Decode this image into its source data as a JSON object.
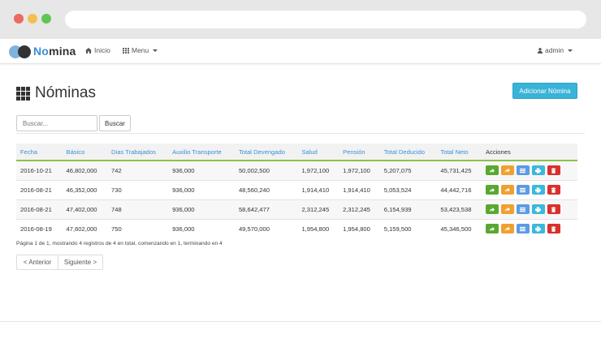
{
  "navbar": {
    "brand_no": "No",
    "brand_mina": "mina",
    "inicio": "Inicio",
    "menu": "Menu",
    "user": "admin"
  },
  "page": {
    "title": "Nóminas",
    "add_button": "Adicionar Nómina"
  },
  "search": {
    "placeholder": "Buscar...",
    "button": "Buscar"
  },
  "table": {
    "headers": [
      "Fecha",
      "Básico",
      "Dias Trabajados",
      "Auxilio Transporte",
      "Total Devengado",
      "Salud",
      "Pensión",
      "Total Deducido",
      "Total Neto",
      "Acciones"
    ],
    "rows": [
      [
        "2016-10-21",
        "46,802,000",
        "742",
        "936,000",
        "50,002,500",
        "1,972,100",
        "1,972,100",
        "5,207,075",
        "45,731,425"
      ],
      [
        "2016-08-21",
        "46,352,000",
        "730",
        "936,000",
        "48,560,240",
        "1,914,410",
        "1,914,410",
        "5,053,524",
        "44,442,716"
      ],
      [
        "2016-08-21",
        "47,402,000",
        "748",
        "936,000",
        "58,642,477",
        "2,312,245",
        "2,312,245",
        "6,154,939",
        "53,423,538"
      ],
      [
        "2016-08-19",
        "47,602,000",
        "750",
        "936,000",
        "49,570,000",
        "1,954,800",
        "1,954,800",
        "5,159,500",
        "45,346,500"
      ]
    ]
  },
  "pagination": {
    "info": "Página 1 de 1, mostrando 4 registros de 4 en total, comenzando en 1, terminando en 4",
    "prev": "< Anterior",
    "next": "Siguiente >"
  },
  "colors": {
    "accent": "#3a8ed8",
    "add_button": "#39b3d7",
    "header_border": "#8bc34a"
  },
  "icons": {
    "actions": [
      "share-arrow-icon",
      "forward-arrow-icon",
      "list-icon",
      "print-icon",
      "trash-icon"
    ]
  }
}
